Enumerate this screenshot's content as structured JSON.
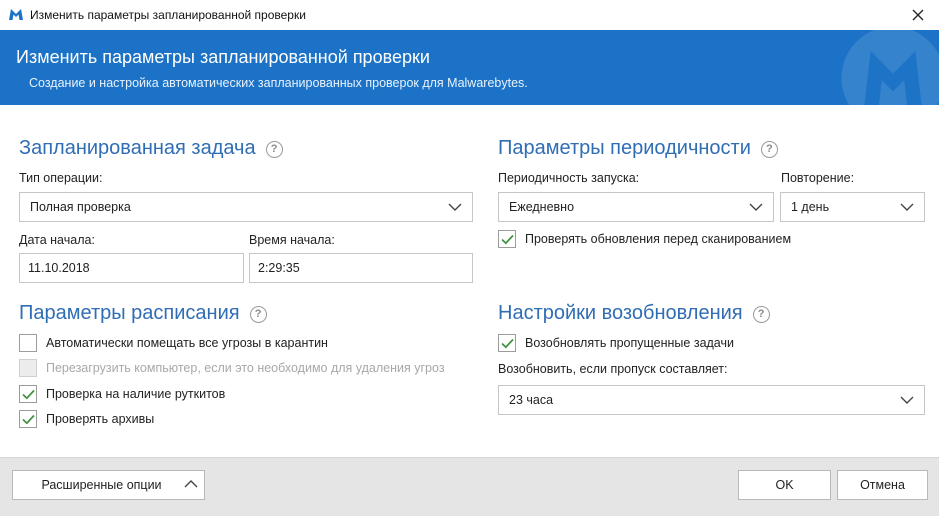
{
  "window": {
    "title": "Изменить параметры запланированной проверки"
  },
  "banner": {
    "title": "Изменить параметры запланированной проверки",
    "subtitle": "Создание и настройка автоматических запланированных проверок для Malwarebytes."
  },
  "scheduled_task": {
    "heading": "Запланированная задача",
    "operation_type_label": "Тип операции:",
    "operation_type_value": "Полная проверка",
    "start_date_label": "Дата начала:",
    "start_date_value": "11.10.2018",
    "start_time_label": "Время начала:",
    "start_time_value": "2:29:35"
  },
  "schedule_params": {
    "heading": "Параметры расписания",
    "options": [
      {
        "label": "Автоматически помещать все угрозы в карантин",
        "checked": false,
        "disabled": false
      },
      {
        "label": "Перезагрузить компьютер, если это необходимо для удаления угроз",
        "checked": false,
        "disabled": true
      },
      {
        "label": "Проверка на наличие руткитов",
        "checked": true,
        "disabled": false
      },
      {
        "label": "Проверять архивы",
        "checked": true,
        "disabled": false
      }
    ]
  },
  "frequency": {
    "heading": "Параметры периодичности",
    "run_frequency_label": "Периодичность запуска:",
    "run_frequency_value": "Ежедневно",
    "repeat_label": "Повторение:",
    "repeat_value": "1 день",
    "check_updates_label": "Проверять обновления перед сканированием",
    "check_updates_checked": true
  },
  "resume": {
    "heading": "Настройки возобновления",
    "resume_missed_label": "Возобновлять пропущенные задачи",
    "resume_missed_checked": true,
    "resume_if_label": "Возобновить, если пропуск составляет:",
    "resume_if_value": "23 часа"
  },
  "footer": {
    "advanced_label": "Расширенные опции",
    "ok_label": "OK",
    "cancel_label": "Отмена"
  },
  "colors": {
    "accent": "#1b72c6",
    "heading": "#2f6db5",
    "check": "#3d8f3d"
  }
}
